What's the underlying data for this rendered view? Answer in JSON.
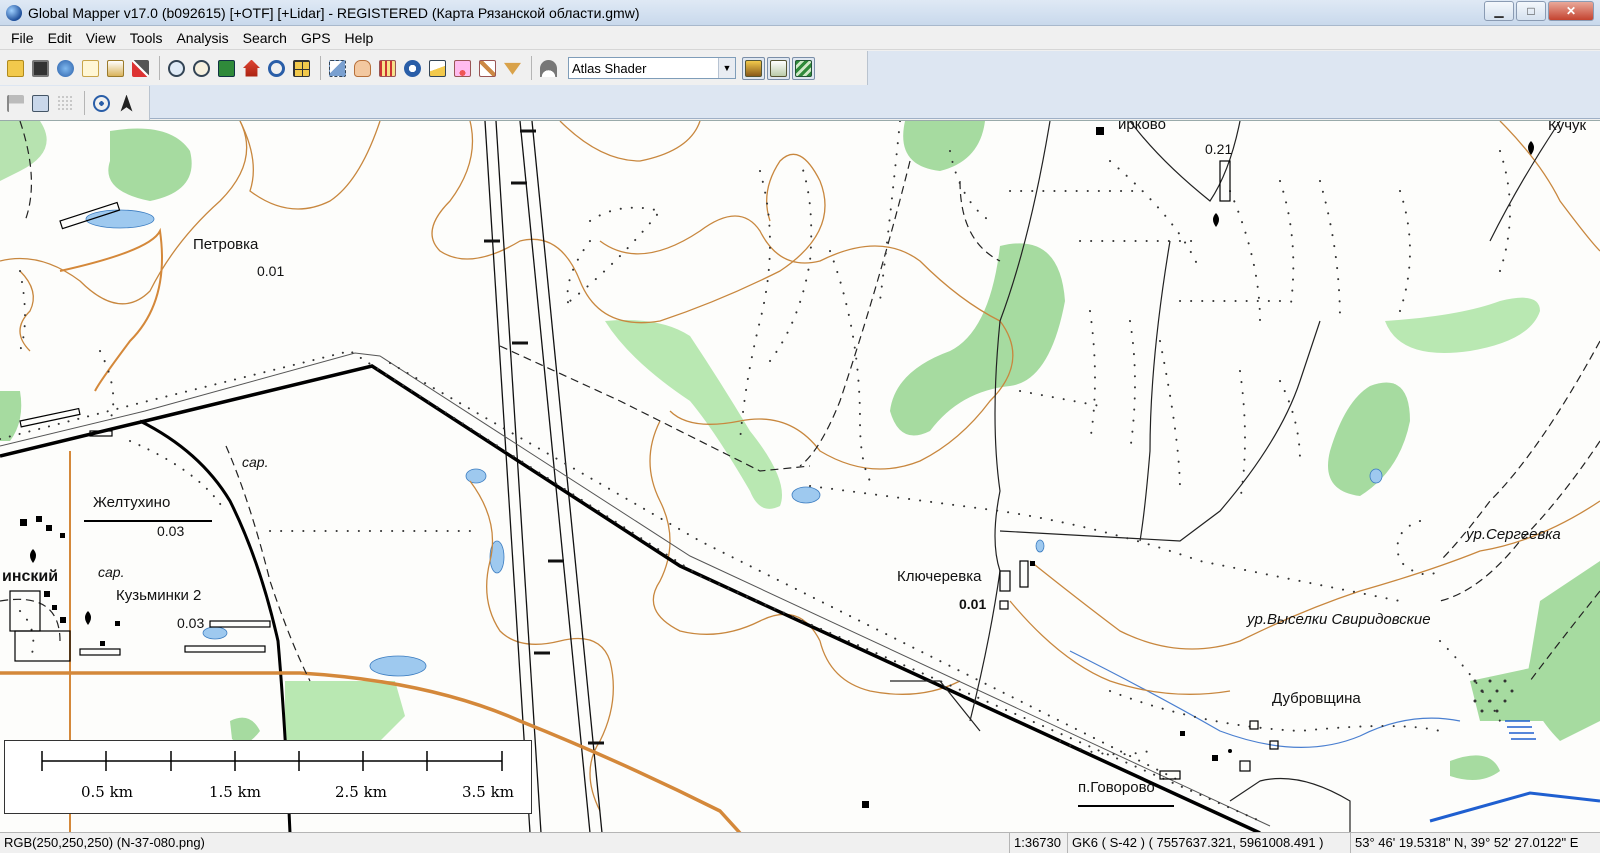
{
  "window": {
    "title": "Global Mapper v17.0 (b092615) [+OTF] [+Lidar] - REGISTERED (Карта Рязанской области.gmw)",
    "minimize": "▁",
    "maximize": "□",
    "close": "✕"
  },
  "menu": [
    "File",
    "Edit",
    "View",
    "Tools",
    "Analysis",
    "Search",
    "GPS",
    "Help"
  ],
  "toolbar": {
    "shader_value": "Atlas Shader",
    "shader_arrow": "▼"
  },
  "map": {
    "labels": {
      "petrovka": "Петровка",
      "petrovka_val": "0.01",
      "sar1": "сар.",
      "zheltukhino": "Желтухино",
      "zheltukhino_val": "0.03",
      "inskiy": "инский",
      "sar2": "сар.",
      "kuzminki": "Кузьминки 2",
      "kuzminki_val": "0.03",
      "klyucherevka": "Ключеревка",
      "klyucherevka_val": "0.01",
      "dubrovshchina": "Дубровщина",
      "govorovo": "п.Говорово",
      "sergeevka": "ур.Сергеевка",
      "vyselki": "ур.Выселки Свиридовские",
      "kirkovo": "ирково",
      "kirkovo_val": "0.21",
      "kuchuk": "Кучук"
    }
  },
  "scalebar": {
    "labels": [
      "0.5 km",
      "1.5 km",
      "2.5 km",
      "3.5 km"
    ]
  },
  "status": {
    "pixel": "RGB(250,250,250) (N-37-080.png)",
    "scale": "1:36730",
    "projection": "GK6 ( S-42 ) ( 7557637.321, 5961008.491 )",
    "coords": "53° 46' 19.5318\" N, 39° 52' 27.0122\" E"
  },
  "colors": {
    "forest": "#a6dba0",
    "forest_light": "#c8eec0",
    "water": "#9ec9ef",
    "contour": "#c8873e",
    "railway": "#1a1a1a",
    "road_major": "#000000",
    "road_orange": "#d4883a"
  }
}
